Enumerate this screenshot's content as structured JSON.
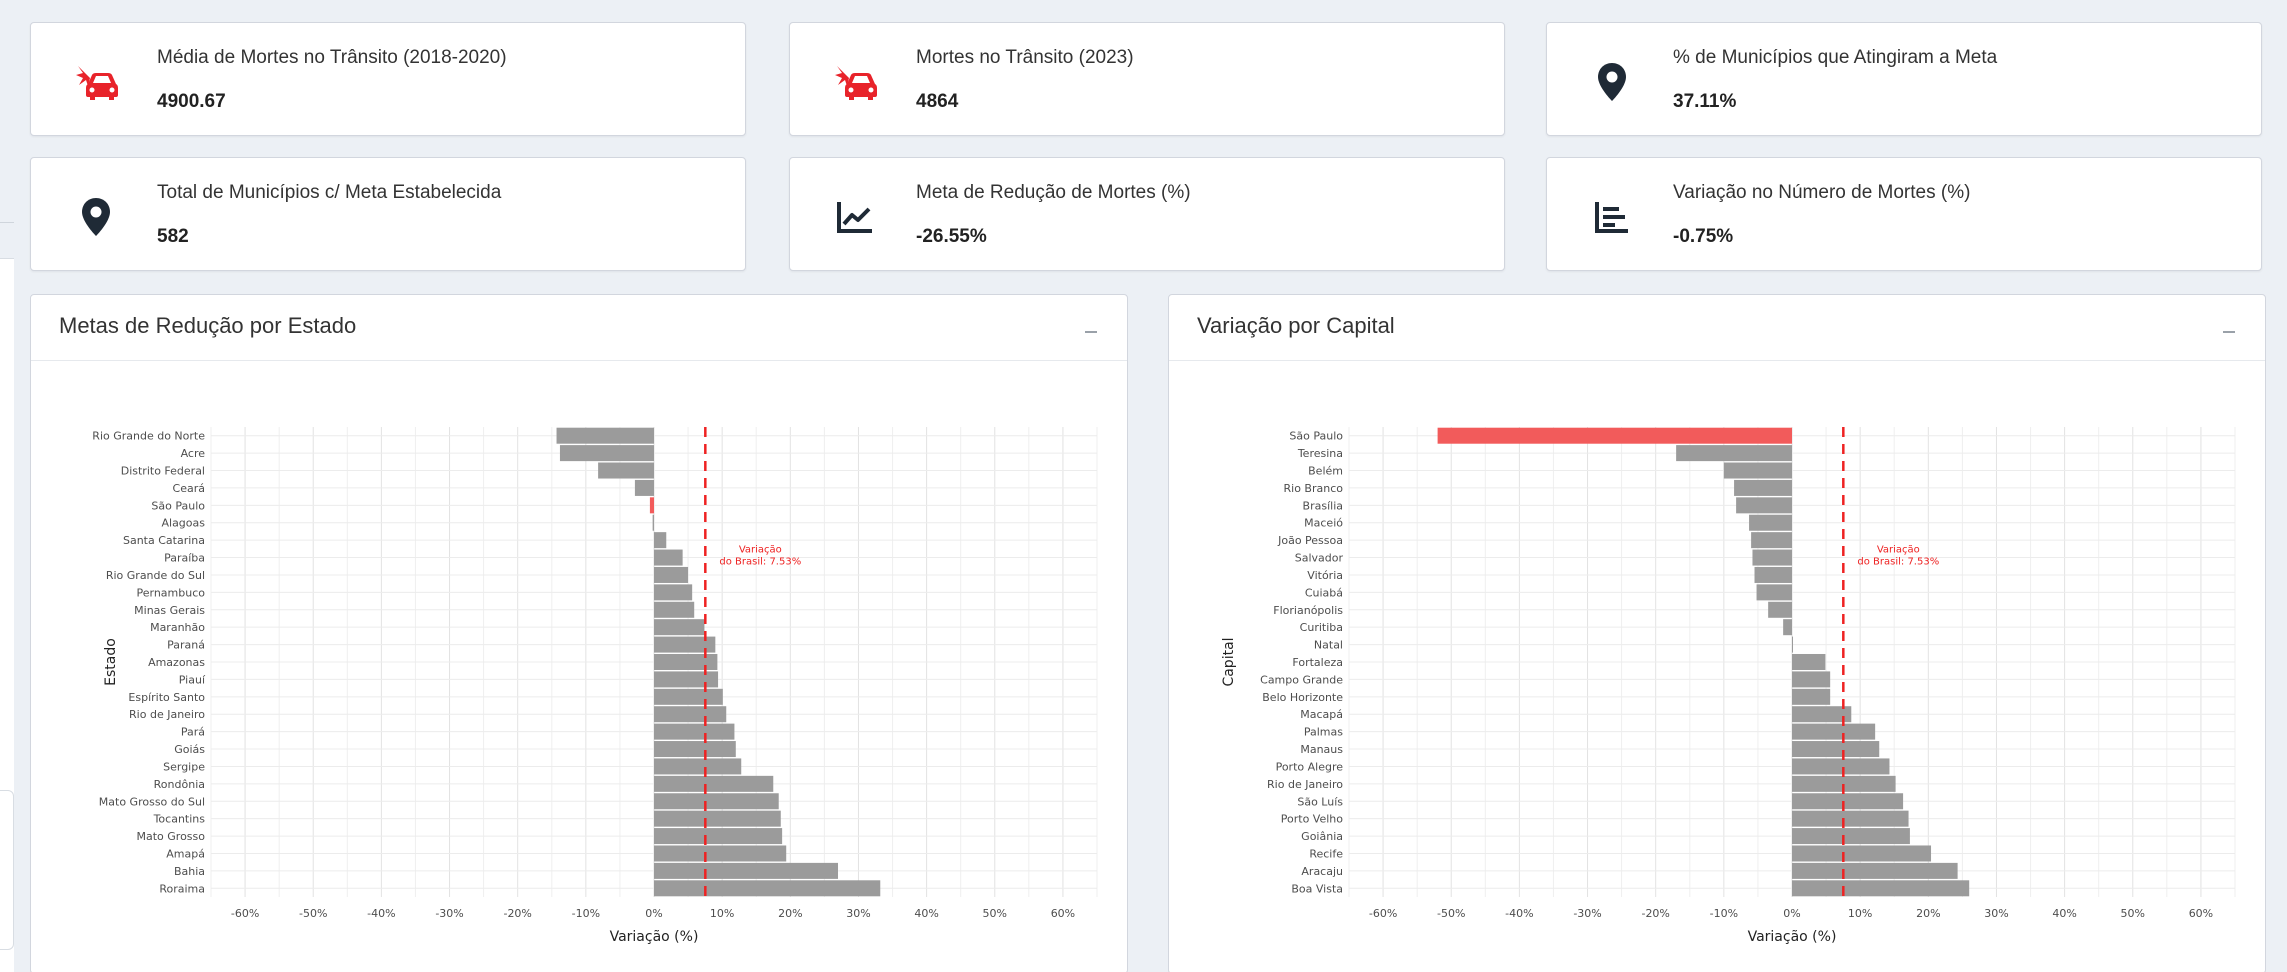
{
  "kpis": [
    {
      "label": "Média de Mortes no Trânsito (2018-2020)",
      "value": "4900.67",
      "icon": "car-crash-icon"
    },
    {
      "label": "Mortes no Trânsito (2023)",
      "value": "4864",
      "icon": "car-crash-icon"
    },
    {
      "label": "% de Municípios que Atingiram a Meta",
      "value": "37.11%",
      "icon": "map-pin-icon"
    },
    {
      "label": "Total de Municípios c/ Meta Estabelecida",
      "value": "582",
      "icon": "map-pin-icon"
    },
    {
      "label": "Meta de Redução de Mortes (%)",
      "value": "-26.55%",
      "icon": "line-chart-icon"
    },
    {
      "label": "Variação no Número de Mortes (%)",
      "value": "-0.75%",
      "icon": "bar-list-icon"
    }
  ],
  "colors": {
    "bar": "#9b9b9b",
    "highlight": "#f25b5b",
    "refline": "#ee2222",
    "accent_icon": "#e8232a",
    "dark_icon": "#1f2a36"
  },
  "panels": {
    "estado": {
      "title": "Metas de Redução por Estado"
    },
    "capital": {
      "title": "Variação por Capital"
    }
  },
  "chart_data": [
    {
      "type": "bar",
      "orientation": "horizontal",
      "xlabel": "Variação (%)",
      "ylabel": "Estado",
      "xlim": [
        -65,
        65
      ],
      "xticks": [
        "-60%",
        "-50%",
        "-40%",
        "-30%",
        "-20%",
        "-10%",
        "0%",
        "10%",
        "20%",
        "30%",
        "40%",
        "50%",
        "60%"
      ],
      "grid": true,
      "reference_line": {
        "value": 7.53,
        "label_line1": "Variação",
        "label_line2": "do Brasil: 7.53%"
      },
      "highlight": "São Paulo",
      "categories": [
        "Rio Grande do Norte",
        "Acre",
        "Distrito Federal",
        "Ceará",
        "São Paulo",
        "Alagoas",
        "Santa Catarina",
        "Paraíba",
        "Rio Grande do Sul",
        "Pernambuco",
        "Minas Gerais",
        "Maranhão",
        "Paraná",
        "Amazonas",
        "Piauí",
        "Espírito Santo",
        "Rio de Janeiro",
        "Pará",
        "Goiás",
        "Sergipe",
        "Rondônia",
        "Mato Grosso do Sul",
        "Tocantins",
        "Mato Grosso",
        "Amapá",
        "Bahia",
        "Roraima"
      ],
      "values": [
        -14.3,
        -13.8,
        -8.2,
        -2.8,
        -0.6,
        -0.2,
        1.8,
        4.2,
        5.0,
        5.6,
        5.9,
        7.4,
        9.0,
        9.3,
        9.4,
        10.1,
        10.6,
        11.8,
        12.0,
        12.8,
        17.5,
        18.3,
        18.6,
        18.8,
        19.4,
        27.0,
        33.2
      ]
    },
    {
      "type": "bar",
      "orientation": "horizontal",
      "xlabel": "Variação (%)",
      "ylabel": "Capital",
      "xlim": [
        -65,
        65
      ],
      "xticks": [
        "-60%",
        "-50%",
        "-40%",
        "-30%",
        "-20%",
        "-10%",
        "0%",
        "10%",
        "20%",
        "30%",
        "40%",
        "50%",
        "60%"
      ],
      "grid": true,
      "reference_line": {
        "value": 7.53,
        "label_line1": "Variação",
        "label_line2": "do Brasil: 7.53%"
      },
      "highlight": "São Paulo",
      "categories": [
        "São Paulo",
        "Teresina",
        "Belém",
        "Rio Branco",
        "Brasília",
        "Maceió",
        "João Pessoa",
        "Salvador",
        "Vitória",
        "Cuiabá",
        "Florianópolis",
        "Curitiba",
        "Natal",
        "Fortaleza",
        "Campo Grande",
        "Belo Horizonte",
        "Macapá",
        "Palmas",
        "Manaus",
        "Porto Alegre",
        "Rio de Janeiro",
        "São Luís",
        "Porto Velho",
        "Goiânia",
        "Recife",
        "Aracaju",
        "Boa Vista"
      ],
      "values": [
        -52.0,
        -17.0,
        -10.0,
        -8.5,
        -8.2,
        -6.3,
        -6.0,
        -5.8,
        -5.5,
        -5.2,
        -3.5,
        -1.3,
        0.1,
        4.9,
        5.6,
        5.6,
        8.7,
        12.2,
        12.8,
        14.3,
        15.2,
        16.3,
        17.1,
        17.3,
        20.4,
        24.3,
        26.0
      ]
    }
  ]
}
